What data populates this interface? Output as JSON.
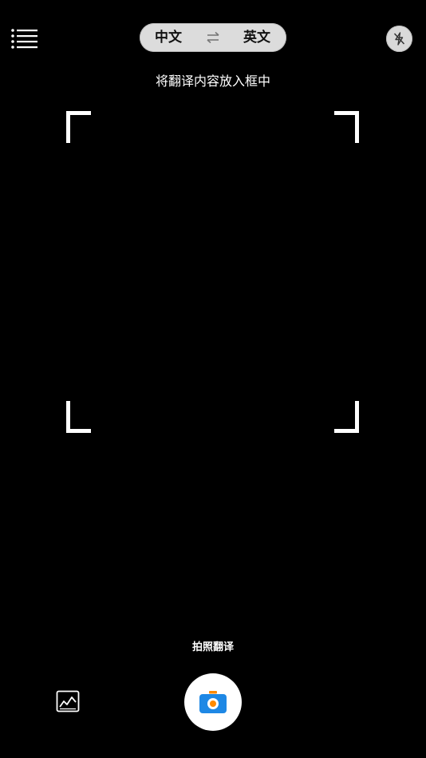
{
  "header": {
    "menu_icon": "list-menu-icon",
    "source_language": "中文",
    "swap_icon": "swap-arrows-icon",
    "target_language": "英文",
    "flash_icon": "flash-off-icon"
  },
  "viewfinder": {
    "hint": "将翻译内容放入框中"
  },
  "bottom": {
    "mode_label": "拍照翻译",
    "gallery_icon": "image-gallery-icon",
    "shutter_icon": "camera-icon"
  },
  "colors": {
    "background": "#000000",
    "pill": "#dcdcdc",
    "camera_body": "#1e88e5",
    "camera_lens": "#ff8a00"
  }
}
